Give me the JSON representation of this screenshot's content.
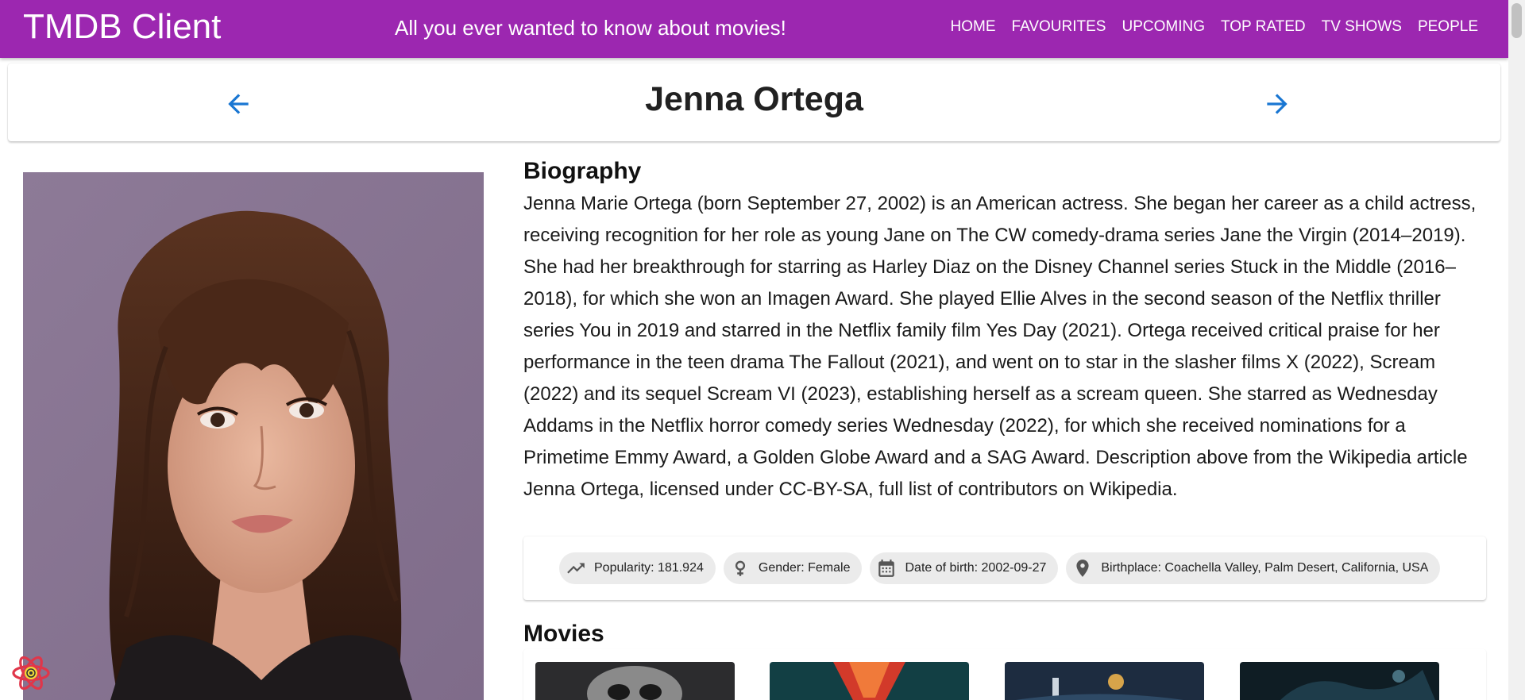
{
  "app": {
    "brand": "TMDB Client",
    "tagline": "All you ever wanted to know about movies!",
    "nav": [
      "HOME",
      "FAVOURITES",
      "UPCOMING",
      "TOP RATED",
      "TV SHOWS",
      "PEOPLE"
    ]
  },
  "person": {
    "name": "Jenna Ortega",
    "biography_heading": "Biography",
    "biography": "Jenna Marie Ortega (born September 27, 2002) is an American actress. She began her career as a child actress, receiving recognition for her role as young Jane on The CW comedy-drama series Jane the Virgin (2014–2019). She had her breakthrough for starring as Harley Diaz on the Disney Channel series Stuck in the Middle (2016–2018), for which she won an Imagen Award. She played Ellie Alves in the second season of the Netflix thriller series You in 2019 and starred in the Netflix family film Yes Day (2021). Ortega received critical praise for her performance in the teen drama The Fallout (2021), and went on to star in the slasher films X (2022), Scream (2022) and its sequel Scream VI (2023), establishing herself as a scream queen. She starred as Wednesday Addams in the Netflix horror comedy series Wednesday (2022), for which she received nominations for a Primetime Emmy Award, a Golden Globe Award and a SAG Award. Description above from the Wikipedia article Jenna Ortega, licensed under CC-BY-SA, full list of contributors on Wikipedia.",
    "chips": {
      "popularity": "Popularity: 181.924",
      "gender": "Gender: Female",
      "dob": "Date of birth: 2002-09-27",
      "birthplace": "Birthplace: Coachella Valley, Palm Desert, California, USA"
    },
    "movies_heading": "Movies"
  },
  "icons": {
    "prev": "arrow-back-icon",
    "next": "arrow-forward-icon",
    "popularity": "trending-up-icon",
    "gender": "female-icon",
    "dob": "calendar-icon",
    "birthplace": "location-pin-icon",
    "devtools": "react-devtools-icon"
  },
  "colors": {
    "appbar": "#9c27b0",
    "arrows": "#1976d2",
    "chip_bg": "#ebebeb"
  }
}
